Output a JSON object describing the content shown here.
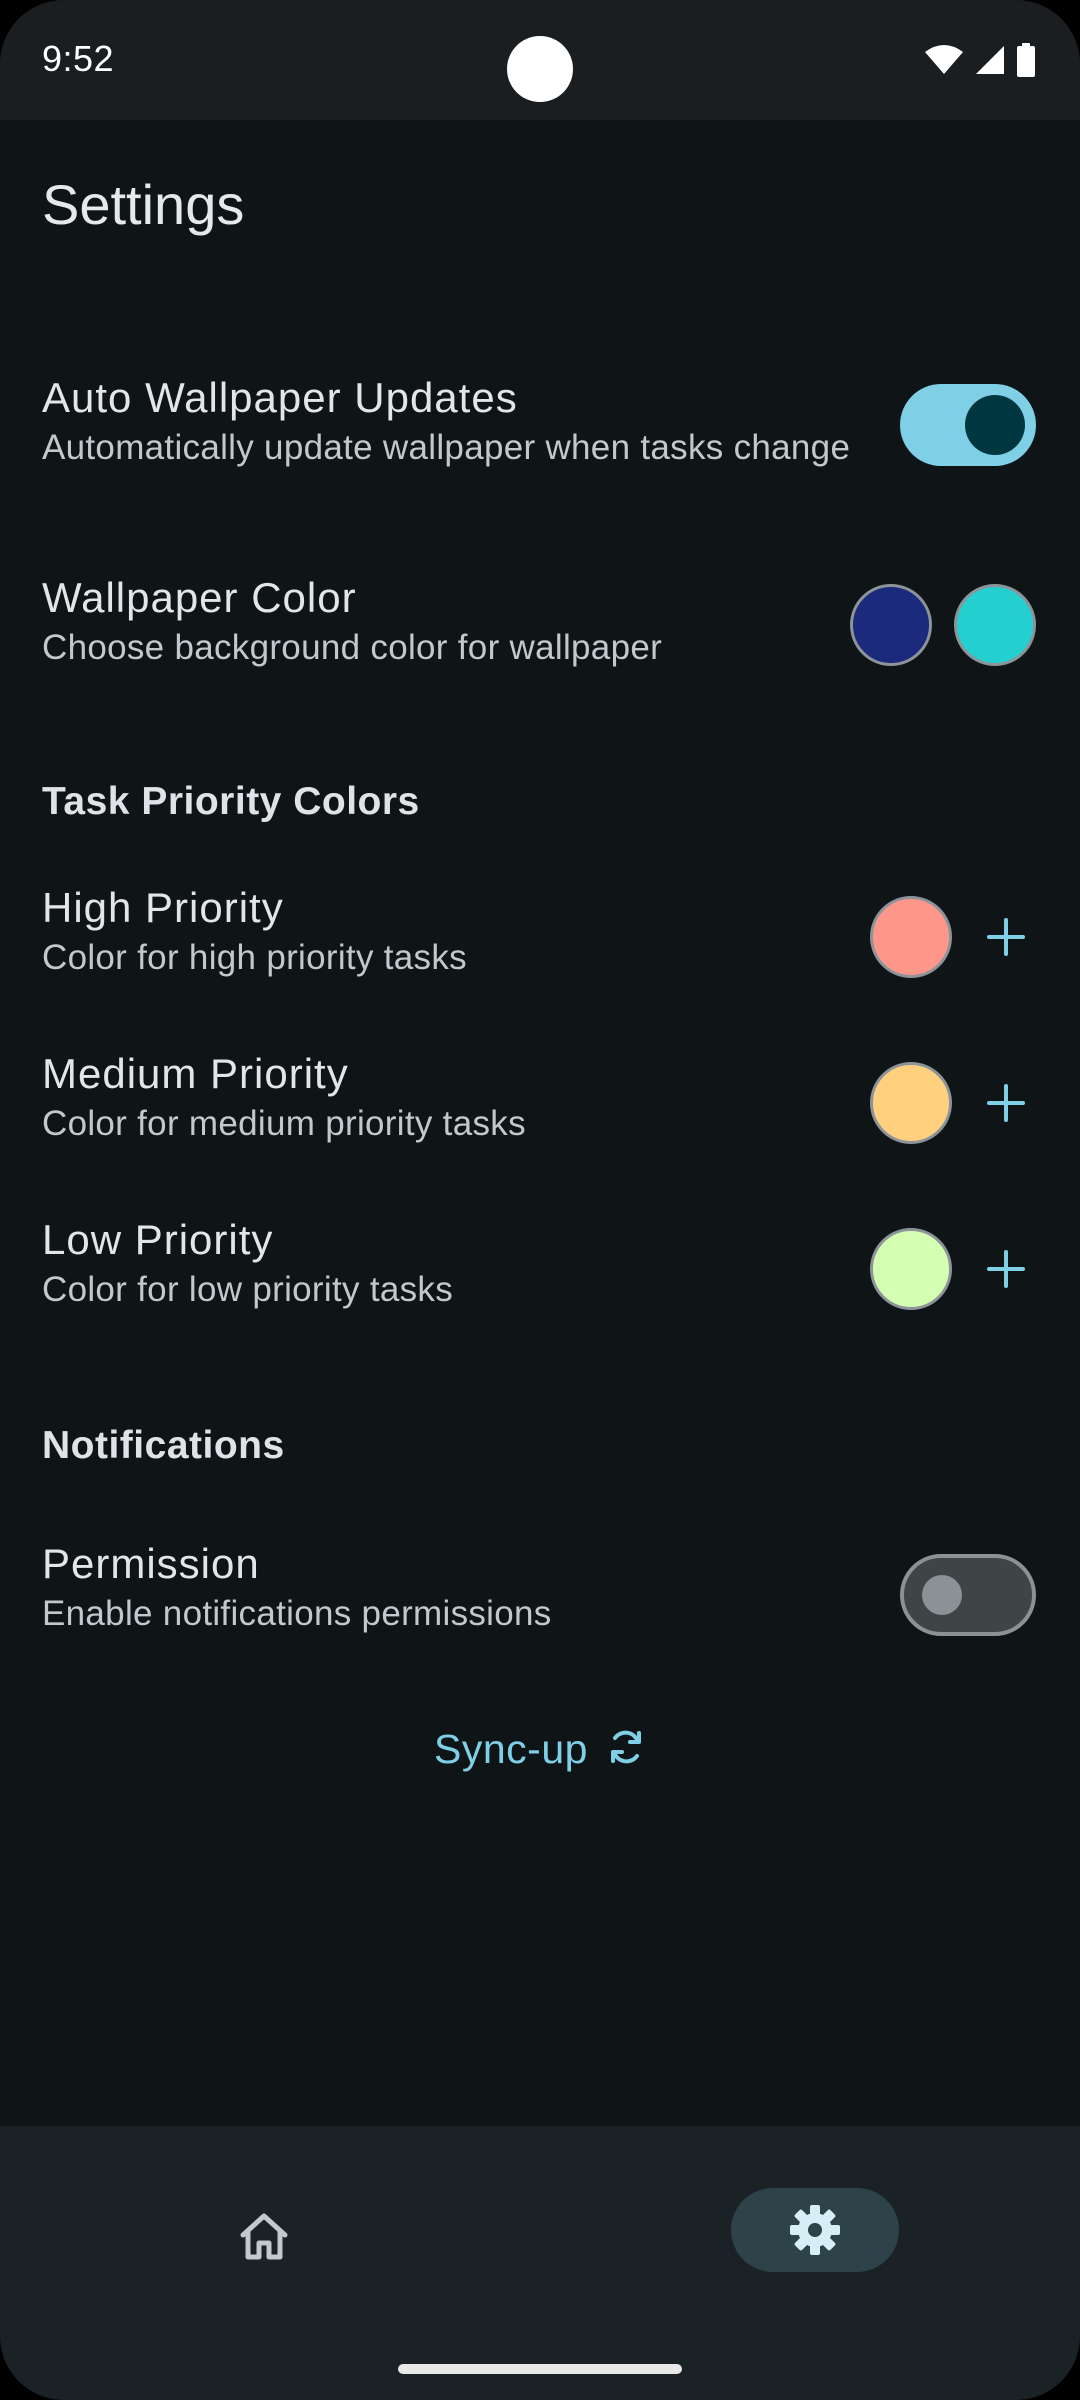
{
  "status_bar": {
    "time": "9:52"
  },
  "page": {
    "title": "Settings"
  },
  "auto_wallpaper": {
    "title": "Auto Wallpaper Updates",
    "subtitle": "Automatically update wallpaper when tasks change",
    "enabled": true
  },
  "wallpaper_color": {
    "title": "Wallpaper Color",
    "subtitle": "Choose background color for wallpaper",
    "swatches": [
      "#1b2a7c",
      "#24d0cf"
    ]
  },
  "task_priority": {
    "header": "Task Priority Colors",
    "items": [
      {
        "title": "High Priority",
        "subtitle": "Color for high priority tasks",
        "color": "#ff968a"
      },
      {
        "title": "Medium Priority",
        "subtitle": "Color for medium priority tasks",
        "color": "#ffd17f"
      },
      {
        "title": "Low Priority",
        "subtitle": "Color for low priority tasks",
        "color": "#d4ffb3"
      }
    ]
  },
  "notifications": {
    "header": "Notifications",
    "permission": {
      "title": "Permission",
      "subtitle": "Enable notifications permissions",
      "enabled": false
    }
  },
  "sync": {
    "label": "Sync-up",
    "icon": "sync-icon"
  },
  "bottom_nav": {
    "items": [
      {
        "icon": "home-icon",
        "selected": false
      },
      {
        "icon": "gear-icon",
        "selected": true
      }
    ]
  },
  "colors": {
    "background": "#0f1417",
    "accent": "#7fcfe6",
    "nav_background": "#1a2226"
  }
}
